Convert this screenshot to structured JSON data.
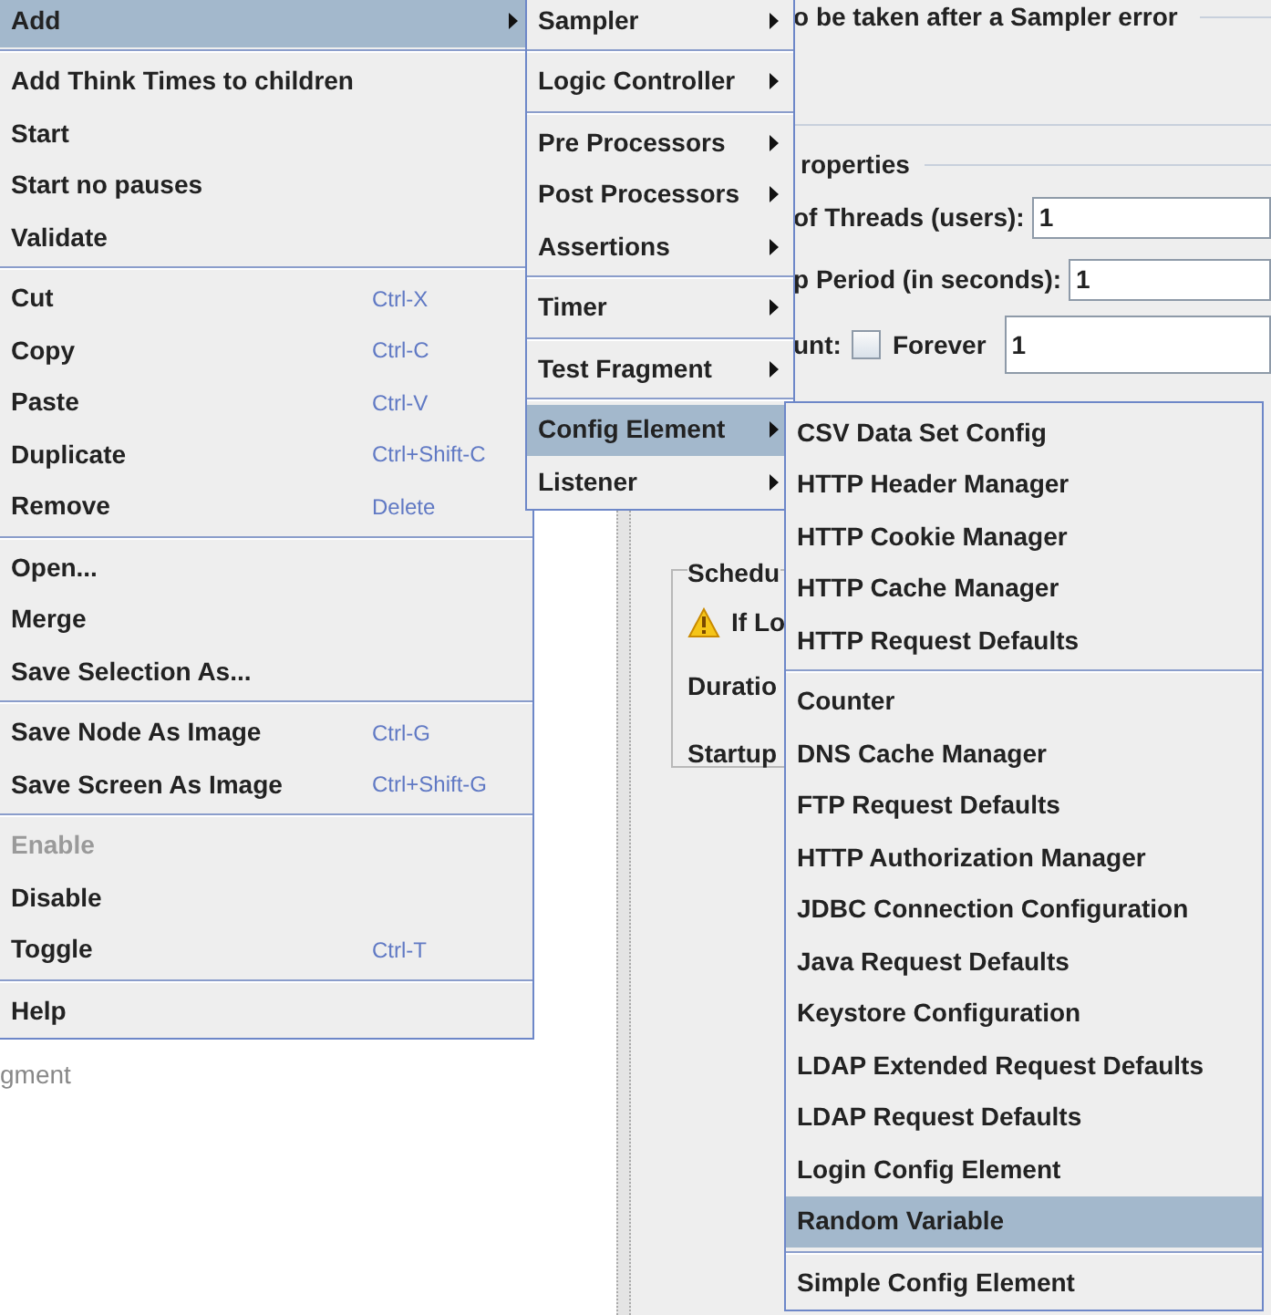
{
  "background": {
    "error_action_label": "o be taken after a Sampler error",
    "properties_legend": "roperties",
    "threads": {
      "label": "of Threads (users):",
      "value": "1"
    },
    "ramp_up": {
      "label": "p Period (in seconds):",
      "value": "1"
    },
    "loop_count": {
      "label": "unt:",
      "forever": {
        "label": "Forever",
        "checked": false
      },
      "value": "1"
    },
    "scheduler": {
      "legend": "Schedu",
      "warning": "If Lo",
      "duration_label": "Duratio",
      "startup_label": "Startup"
    },
    "tree_item": "gment"
  },
  "context_menu": {
    "groups": [
      [
        {
          "label": "Add",
          "submenu": true,
          "selected": true,
          "disabled": false
        }
      ],
      [
        {
          "label": "Add Think Times to children",
          "submenu": false,
          "selected": false,
          "disabled": false
        },
        {
          "label": "Start",
          "submenu": false,
          "selected": false,
          "disabled": false
        },
        {
          "label": "Start no pauses",
          "submenu": false,
          "selected": false,
          "disabled": false
        },
        {
          "label": "Validate",
          "submenu": false,
          "selected": false,
          "disabled": false
        }
      ],
      [
        {
          "label": "Cut",
          "shortcut": "Ctrl-X",
          "submenu": false,
          "selected": false,
          "disabled": false
        },
        {
          "label": "Copy",
          "shortcut": "Ctrl-C",
          "submenu": false,
          "selected": false,
          "disabled": false
        },
        {
          "label": "Paste",
          "shortcut": "Ctrl-V",
          "submenu": false,
          "selected": false,
          "disabled": false
        },
        {
          "label": "Duplicate",
          "shortcut": "Ctrl+Shift-C",
          "submenu": false,
          "selected": false,
          "disabled": false
        },
        {
          "label": "Remove",
          "shortcut": "Delete",
          "submenu": false,
          "selected": false,
          "disabled": false
        }
      ],
      [
        {
          "label": "Open...",
          "submenu": false,
          "selected": false,
          "disabled": false
        },
        {
          "label": "Merge",
          "submenu": false,
          "selected": false,
          "disabled": false
        },
        {
          "label": "Save Selection As...",
          "submenu": false,
          "selected": false,
          "disabled": false
        }
      ],
      [
        {
          "label": "Save Node As Image",
          "shortcut": "Ctrl-G",
          "submenu": false,
          "selected": false,
          "disabled": false
        },
        {
          "label": "Save Screen As Image",
          "shortcut": "Ctrl+Shift-G",
          "submenu": false,
          "selected": false,
          "disabled": false
        }
      ],
      [
        {
          "label": "Enable",
          "submenu": false,
          "selected": false,
          "disabled": true
        },
        {
          "label": "Disable",
          "submenu": false,
          "selected": false,
          "disabled": false
        },
        {
          "label": "Toggle",
          "shortcut": "Ctrl-T",
          "submenu": false,
          "selected": false,
          "disabled": false
        }
      ],
      [
        {
          "label": "Help",
          "submenu": false,
          "selected": false,
          "disabled": false
        }
      ]
    ]
  },
  "add_submenu": {
    "groups": [
      [
        {
          "label": "Sampler",
          "submenu": true,
          "selected": false
        }
      ],
      [
        {
          "label": "Logic Controller",
          "submenu": true,
          "selected": false
        }
      ],
      [
        {
          "label": "Pre Processors",
          "submenu": true,
          "selected": false
        },
        {
          "label": "Post Processors",
          "submenu": true,
          "selected": false
        },
        {
          "label": "Assertions",
          "submenu": true,
          "selected": false
        }
      ],
      [
        {
          "label": "Timer",
          "submenu": true,
          "selected": false
        }
      ],
      [
        {
          "label": "Test Fragment",
          "submenu": true,
          "selected": false
        }
      ],
      [
        {
          "label": "Config Element",
          "submenu": true,
          "selected": true
        },
        {
          "label": "Listener",
          "submenu": true,
          "selected": false
        }
      ]
    ]
  },
  "config_submenu": {
    "groups": [
      [
        {
          "label": "CSV Data Set Config",
          "selected": false
        },
        {
          "label": "HTTP Header Manager",
          "selected": false
        },
        {
          "label": "HTTP Cookie Manager",
          "selected": false
        },
        {
          "label": "HTTP Cache Manager",
          "selected": false
        },
        {
          "label": "HTTP Request Defaults",
          "selected": false
        }
      ],
      [
        {
          "label": "Counter",
          "selected": false
        },
        {
          "label": "DNS Cache Manager",
          "selected": false
        },
        {
          "label": "FTP Request Defaults",
          "selected": false
        },
        {
          "label": "HTTP Authorization Manager",
          "selected": false
        },
        {
          "label": "JDBC Connection Configuration",
          "selected": false
        },
        {
          "label": "Java Request Defaults",
          "selected": false
        },
        {
          "label": "Keystore Configuration",
          "selected": false
        },
        {
          "label": "LDAP Extended Request Defaults",
          "selected": false
        },
        {
          "label": "LDAP Request Defaults",
          "selected": false
        },
        {
          "label": "Login Config Element",
          "selected": false
        },
        {
          "label": "Random Variable",
          "selected": true
        }
      ],
      [
        {
          "label": "Simple Config Element",
          "selected": false
        }
      ]
    ]
  }
}
